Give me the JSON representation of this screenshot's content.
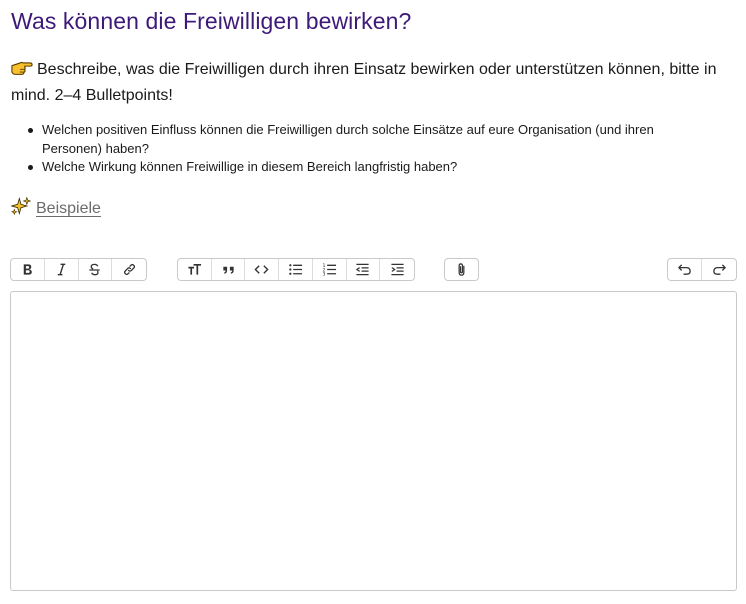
{
  "page": {
    "title": "Was können die Freiwilligen bewirken?",
    "intro_text": "Beschreibe, was die Freiwilligen durch ihren Einsatz bewirken oder unterstützen können, bitte in mind. 2–4 Bulletpoints!",
    "intro_icon": "pointing-hand-icon",
    "bullets": [
      "Welchen positiven Einfluss können die Freiwilligen durch solche Einsätze auf eure Organisation (und ihren Personen) haben?",
      "Welche Wirkung können Freiwillige in diesem Bereich langfristig haben?"
    ],
    "examples_icon": "sparkles-icon",
    "examples_link": "Beispiele"
  },
  "colors": {
    "title": "#3d1a78",
    "text": "#1a1a1a",
    "link": "#6b6b6b",
    "border": "#c9c9c9"
  },
  "toolbar": {
    "groups": [
      [
        "bold-icon",
        "italic-icon",
        "strikethrough-icon",
        "link-icon"
      ],
      [
        "heading-icon",
        "quote-icon",
        "code-icon",
        "bullet-list-icon",
        "numbered-list-icon",
        "decrease-indent-icon",
        "increase-indent-icon"
      ],
      [
        "attach-icon"
      ],
      [
        "undo-icon",
        "redo-icon"
      ]
    ]
  },
  "editor": {
    "value": ""
  }
}
